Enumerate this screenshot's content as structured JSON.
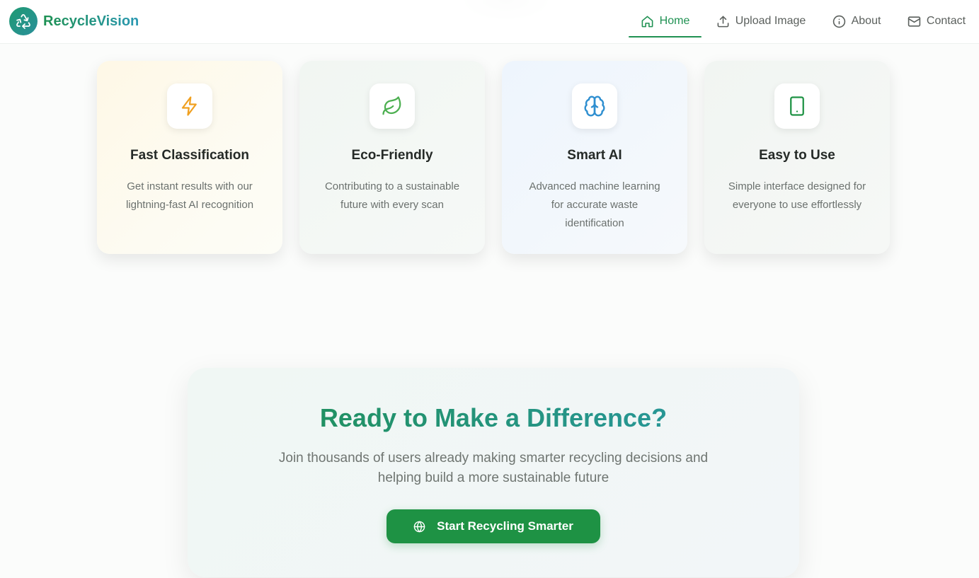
{
  "brand": {
    "name": "RecycleVision",
    "logo_icon": "recycle-icon"
  },
  "nav": {
    "items": [
      {
        "label": "Home",
        "icon": "home-icon",
        "active": true
      },
      {
        "label": "Upload Image",
        "icon": "upload-icon",
        "active": false
      },
      {
        "label": "About",
        "icon": "info-icon",
        "active": false
      },
      {
        "label": "Contact",
        "icon": "mail-icon",
        "active": false
      }
    ]
  },
  "features": [
    {
      "title": "Fast Classification",
      "description": "Get instant results with our lightning-fast AI recognition",
      "icon": "lightning-icon",
      "icon_color": "#f0a020"
    },
    {
      "title": "Eco-Friendly",
      "description": "Contributing to a sustainable future with every scan",
      "icon": "leaf-icon",
      "icon_color": "#4caf50"
    },
    {
      "title": "Smart AI",
      "description": "Advanced machine learning for accurate waste identification",
      "icon": "brain-icon",
      "icon_color": "#2f8fd0"
    },
    {
      "title": "Easy to Use",
      "description": "Simple interface designed for everyone to use effortlessly",
      "icon": "smartphone-icon",
      "icon_color": "#1e9244"
    }
  ],
  "cta": {
    "heading": "Ready to Make a Difference?",
    "text": "Join thousands of users already making smarter recycling decisions and helping build a more sustainable future",
    "button_label": "Start Recycling Smarter",
    "button_icon": "globe-icon"
  },
  "colors": {
    "primary_green": "#1e9244",
    "accent_teal": "#2a98a8",
    "nav_text": "#5a5f5c"
  }
}
